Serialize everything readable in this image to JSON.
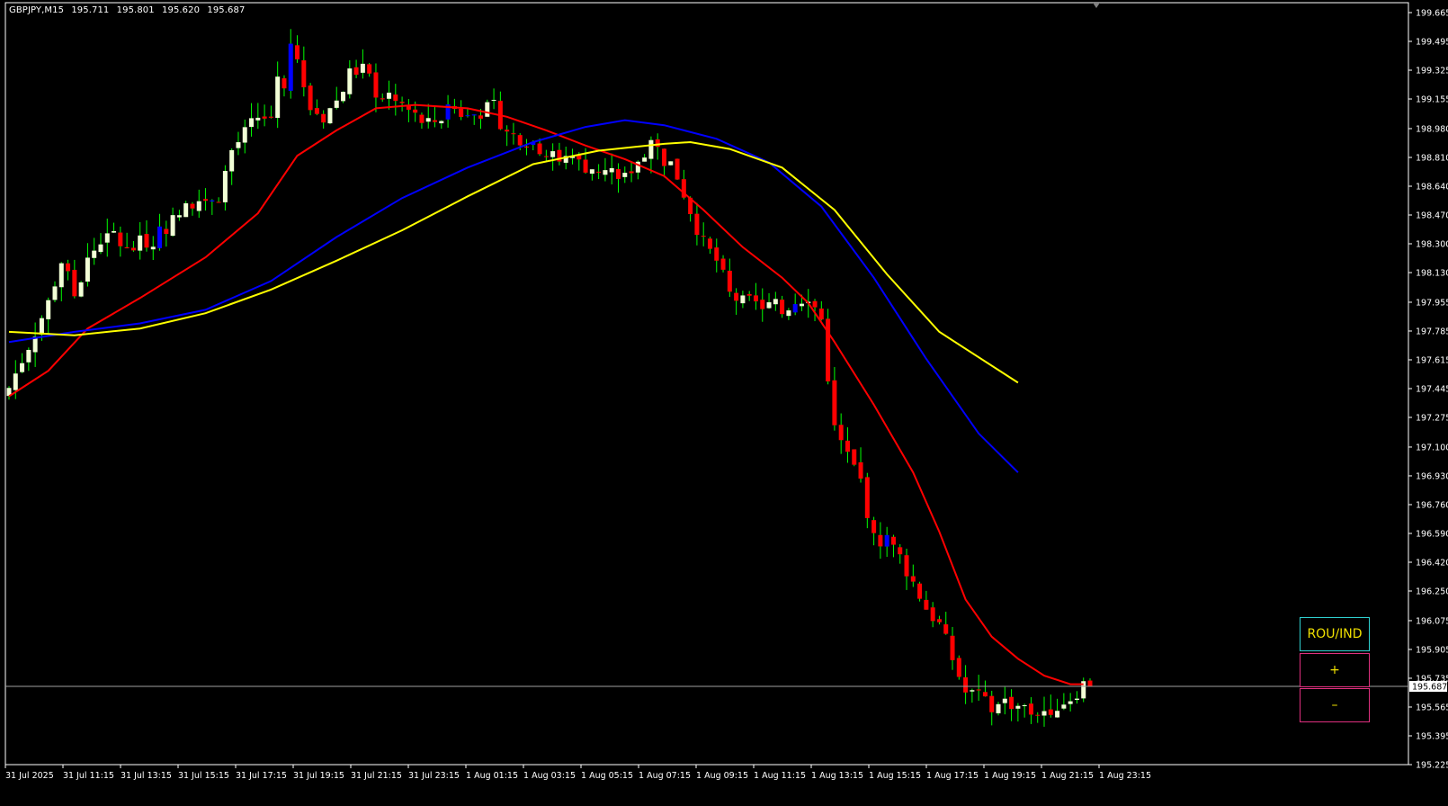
{
  "header": {
    "symbol": "GBPJPY,M15",
    "open": "195.711",
    "high": "195.801",
    "low": "195.620",
    "close": "195.687"
  },
  "panel": {
    "title_label": "ROU/IND",
    "plus_label": "+",
    "minus_label": "–"
  },
  "colors": {
    "background": "#000000",
    "bull_body": "#f2ffd6",
    "bear_body": "#ff0000",
    "wick": "#00ff00",
    "alt_bull": "#0000ff",
    "ma_fast": "#ff0000",
    "ma_mid": "#0000ff",
    "ma_slow": "#ffff00",
    "axis": "#ffffff",
    "price_line": "#a0a0a0"
  },
  "chart_data": {
    "type": "candlestick",
    "title": "GBPJPY,M15",
    "ylim": [
      195.225,
      199.665
    ],
    "y_ticks": [
      "199.665",
      "199.495",
      "199.325",
      "199.155",
      "198.980",
      "198.810",
      "198.640",
      "198.470",
      "198.300",
      "198.130",
      "197.955",
      "197.785",
      "197.615",
      "197.445",
      "197.275",
      "197.100",
      "196.930",
      "196.760",
      "196.590",
      "196.420",
      "196.250",
      "196.075",
      "195.905",
      "195.735",
      "195.565",
      "195.395",
      "195.225"
    ],
    "x_ticks": [
      "31 Jul 2025",
      "31 Jul 11:15",
      "31 Jul 13:15",
      "31 Jul 15:15",
      "31 Jul 17:15",
      "31 Jul 19:15",
      "31 Jul 21:15",
      "31 Jul 23:15",
      "1 Aug 01:15",
      "1 Aug 03:15",
      "1 Aug 05:15",
      "1 Aug 07:15",
      "1 Aug 09:15",
      "1 Aug 11:15",
      "1 Aug 13:15",
      "1 Aug 15:15",
      "1 Aug 17:15",
      "1 Aug 19:15",
      "1 Aug 21:15",
      "1 Aug 23:15"
    ],
    "current_price": "195.687",
    "close_anchors": [
      [
        0,
        197.45
      ],
      [
        3,
        197.7
      ],
      [
        6,
        197.95
      ],
      [
        8,
        198.2
      ],
      [
        10,
        198.0
      ],
      [
        12,
        198.2
      ],
      [
        14,
        198.32
      ],
      [
        16,
        198.35
      ],
      [
        18,
        198.25
      ],
      [
        20,
        198.3
      ],
      [
        22,
        198.33
      ],
      [
        24,
        198.4
      ],
      [
        26,
        198.47
      ],
      [
        28,
        198.55
      ],
      [
        30,
        198.57
      ],
      [
        32,
        198.59
      ],
      [
        34,
        198.85
      ],
      [
        36,
        198.95
      ],
      [
        38,
        199.05
      ],
      [
        40,
        199.05
      ],
      [
        41,
        199.3
      ],
      [
        42,
        199.2
      ],
      [
        43,
        199.5
      ],
      [
        44,
        199.4
      ],
      [
        45,
        199.2
      ],
      [
        46,
        199.1
      ],
      [
        48,
        199.05
      ],
      [
        50,
        199.15
      ],
      [
        52,
        199.3
      ],
      [
        54,
        199.35
      ],
      [
        56,
        199.2
      ],
      [
        58,
        199.15
      ],
      [
        60,
        199.12
      ],
      [
        62,
        199.05
      ],
      [
        64,
        199.0
      ],
      [
        66,
        199.05
      ],
      [
        68,
        199.1
      ],
      [
        70,
        199.05
      ],
      [
        72,
        199.08
      ],
      [
        74,
        199.1
      ],
      [
        76,
        198.95
      ],
      [
        78,
        198.93
      ],
      [
        80,
        198.9
      ],
      [
        82,
        198.83
      ],
      [
        84,
        198.8
      ],
      [
        86,
        198.78
      ],
      [
        88,
        198.76
      ],
      [
        90,
        198.74
      ],
      [
        92,
        198.72
      ],
      [
        94,
        198.7
      ],
      [
        96,
        198.8
      ],
      [
        98,
        198.9
      ],
      [
        100,
        198.8
      ],
      [
        102,
        198.7
      ],
      [
        104,
        198.5
      ],
      [
        106,
        198.3
      ],
      [
        108,
        198.2
      ],
      [
        110,
        198.0
      ],
      [
        112,
        197.95
      ],
      [
        114,
        197.94
      ],
      [
        116,
        197.93
      ],
      [
        118,
        197.92
      ],
      [
        120,
        197.96
      ],
      [
        122,
        198.0
      ],
      [
        124,
        197.85
      ],
      [
        126,
        197.2
      ],
      [
        128,
        197.05
      ],
      [
        130,
        196.9
      ],
      [
        132,
        196.55
      ],
      [
        134,
        196.55
      ],
      [
        136,
        196.45
      ],
      [
        138,
        196.3
      ],
      [
        140,
        196.15
      ],
      [
        142,
        196.05
      ],
      [
        144,
        195.85
      ],
      [
        146,
        195.65
      ],
      [
        148,
        195.62
      ],
      [
        150,
        195.55
      ],
      [
        152,
        195.6
      ],
      [
        154,
        195.58
      ],
      [
        156,
        195.53
      ],
      [
        158,
        195.55
      ],
      [
        160,
        195.58
      ],
      [
        162,
        195.62
      ],
      [
        164,
        195.7
      ]
    ],
    "series": [
      {
        "name": "",
        "color": "#ff0000",
        "points": [
          [
            0,
            197.4
          ],
          [
            6,
            197.55
          ],
          [
            12,
            197.8
          ],
          [
            20,
            197.98
          ],
          [
            30,
            198.22
          ],
          [
            38,
            198.48
          ],
          [
            44,
            198.82
          ],
          [
            50,
            198.97
          ],
          [
            56,
            199.1
          ],
          [
            62,
            199.12
          ],
          [
            70,
            199.1
          ],
          [
            76,
            199.05
          ],
          [
            82,
            198.97
          ],
          [
            88,
            198.88
          ],
          [
            94,
            198.8
          ],
          [
            100,
            198.7
          ],
          [
            106,
            198.5
          ],
          [
            112,
            198.28
          ],
          [
            118,
            198.1
          ],
          [
            122,
            197.95
          ],
          [
            126,
            197.72
          ],
          [
            132,
            197.35
          ],
          [
            138,
            196.95
          ],
          [
            142,
            196.6
          ],
          [
            146,
            196.2
          ],
          [
            150,
            195.98
          ],
          [
            154,
            195.85
          ],
          [
            158,
            195.75
          ],
          [
            162,
            195.7
          ],
          [
            164,
            195.7
          ]
        ]
      },
      {
        "name": "",
        "color": "#0000ff",
        "points": [
          [
            0,
            197.72
          ],
          [
            10,
            197.78
          ],
          [
            20,
            197.83
          ],
          [
            30,
            197.91
          ],
          [
            40,
            198.08
          ],
          [
            50,
            198.34
          ],
          [
            60,
            198.57
          ],
          [
            70,
            198.75
          ],
          [
            80,
            198.9
          ],
          [
            88,
            198.99
          ],
          [
            94,
            199.03
          ],
          [
            100,
            199.0
          ],
          [
            108,
            198.92
          ],
          [
            116,
            198.78
          ],
          [
            124,
            198.52
          ],
          [
            132,
            198.1
          ],
          [
            140,
            197.62
          ],
          [
            148,
            197.18
          ],
          [
            154,
            196.95
          ]
        ]
      },
      {
        "name": "",
        "color": "#ffff00",
        "points": [
          [
            0,
            197.78
          ],
          [
            10,
            197.76
          ],
          [
            20,
            197.8
          ],
          [
            30,
            197.89
          ],
          [
            40,
            198.03
          ],
          [
            50,
            198.2
          ],
          [
            60,
            198.38
          ],
          [
            70,
            198.58
          ],
          [
            80,
            198.77
          ],
          [
            90,
            198.85
          ],
          [
            100,
            198.89
          ],
          [
            104,
            198.9
          ],
          [
            110,
            198.86
          ],
          [
            118,
            198.75
          ],
          [
            126,
            198.5
          ],
          [
            134,
            198.12
          ],
          [
            142,
            197.78
          ],
          [
            154,
            197.48
          ]
        ]
      }
    ]
  }
}
